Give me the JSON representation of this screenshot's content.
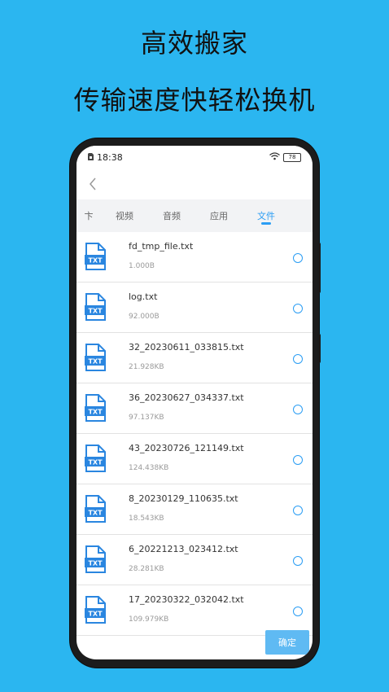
{
  "promo": {
    "title": "高效搬家",
    "subtitle": "传输速度快轻松换机"
  },
  "status_bar": {
    "time": "18:38",
    "battery": "78"
  },
  "tabs": [
    {
      "label": "卞",
      "active": false
    },
    {
      "label": "视频",
      "active": false
    },
    {
      "label": "音频",
      "active": false
    },
    {
      "label": "应用",
      "active": false
    },
    {
      "label": "文件",
      "active": true
    }
  ],
  "files": [
    {
      "name": "fd_tmp_file.txt",
      "size": "1.000B",
      "icon_text": "TXT"
    },
    {
      "name": "log.txt",
      "size": "92.000B",
      "icon_text": "TXT"
    },
    {
      "name": "32_20230611_033815.txt",
      "size": "21.928KB",
      "icon_text": "TXT"
    },
    {
      "name": "36_20230627_034337.txt",
      "size": "97.137KB",
      "icon_text": "TXT"
    },
    {
      "name": "43_20230726_121149.txt",
      "size": "124.438KB",
      "icon_text": "TXT"
    },
    {
      "name": "8_20230129_110635.txt",
      "size": "18.543KB",
      "icon_text": "TXT"
    },
    {
      "name": "6_20221213_023412.txt",
      "size": "28.281KB",
      "icon_text": "TXT"
    },
    {
      "name": "17_20230322_032042.txt",
      "size": "109.979KB",
      "icon_text": "TXT"
    }
  ],
  "confirm_label": "确定",
  "colors": {
    "background": "#2bb6f0",
    "accent": "#2a9df4",
    "file_icon": "#2a86e0",
    "confirm_button": "#5fbaf3"
  }
}
